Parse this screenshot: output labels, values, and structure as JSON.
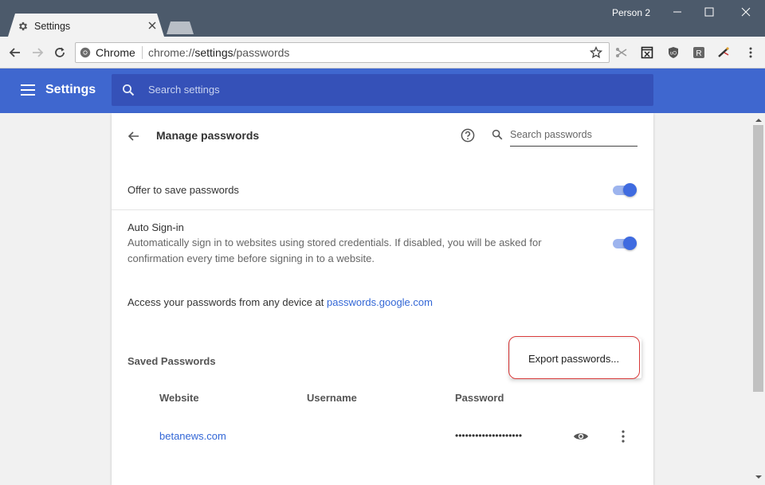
{
  "window": {
    "tab_title": "Settings",
    "profile": "Person 2"
  },
  "omnibox": {
    "origin": "Chrome",
    "scheme": "chrome://",
    "host": "settings",
    "path": "/passwords"
  },
  "header": {
    "title": "Settings",
    "search_placeholder": "Search settings"
  },
  "page": {
    "title": "Manage passwords",
    "search_placeholder": "Search passwords"
  },
  "offer_save": {
    "label": "Offer to save passwords",
    "enabled": true
  },
  "auto_signin": {
    "label": "Auto Sign-in",
    "description_line1": "Automatically sign in to websites using stored credentials. If disabled, you will be asked for",
    "description_line2": "confirmation every time before signing in to a website.",
    "enabled": true
  },
  "access": {
    "text": "Access your passwords from any device at ",
    "link": "passwords.google.com"
  },
  "saved": {
    "title": "Saved Passwords",
    "columns": {
      "website": "Website",
      "username": "Username",
      "password": "Password"
    },
    "rows": [
      {
        "website": "betanews.com",
        "username": "",
        "password": "••••••••••••••••••••"
      }
    ]
  },
  "menu": {
    "export_label": "Export passwords..."
  },
  "colors": {
    "header_blue": "#3f67cf",
    "search_blue": "#3551b8",
    "link_blue": "#3367d6",
    "highlight_red": "#d83a3a",
    "titlebar": "#4c5a6b"
  }
}
